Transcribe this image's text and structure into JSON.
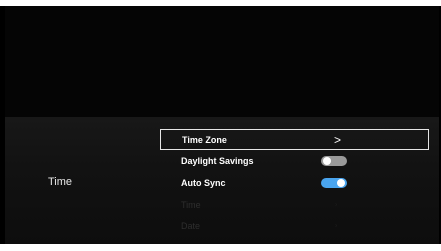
{
  "category": {
    "label": "Time"
  },
  "colors": {
    "toggle_on": "#49a4ee",
    "toggle_off": "#9a9a9a",
    "background": "#000000"
  },
  "menu": {
    "time_zone": {
      "label": "Time Zone",
      "icon": "chevron-right-icon",
      "icon_glyph": ">"
    },
    "daylight_savings": {
      "label": "Daylight Savings",
      "toggle_state": "off"
    },
    "auto_sync": {
      "label": "Auto Sync",
      "toggle_state": "on"
    },
    "time": {
      "label": "Time",
      "disabled": true,
      "indicator": "›"
    },
    "date": {
      "label": "Date",
      "disabled": true,
      "indicator": "›"
    }
  }
}
